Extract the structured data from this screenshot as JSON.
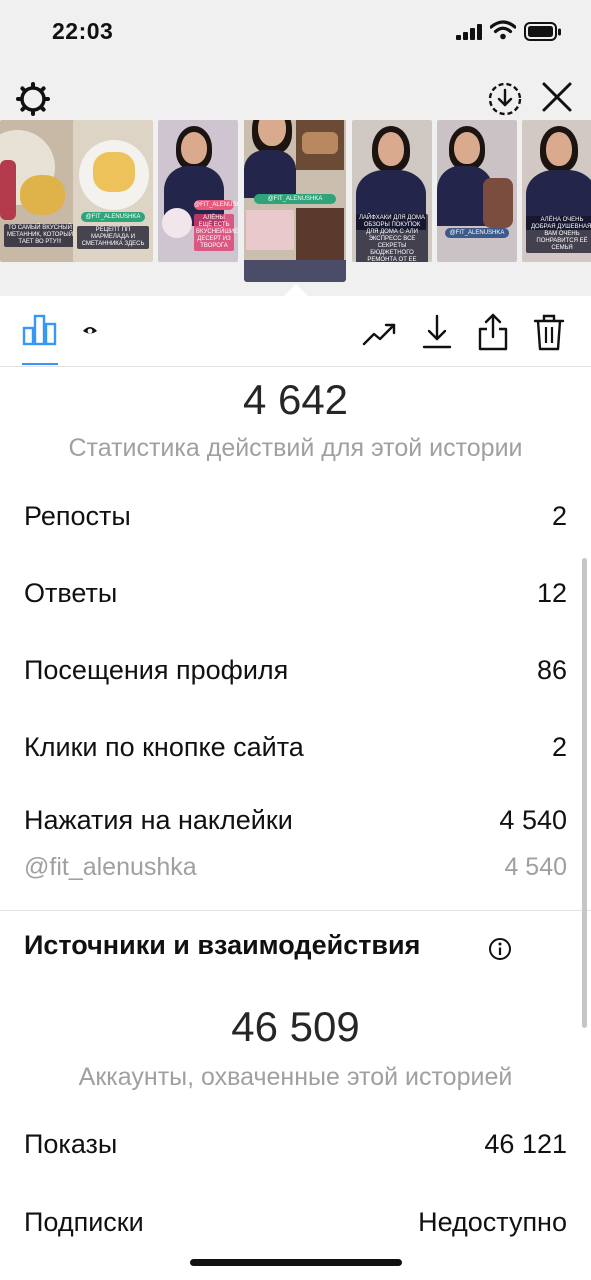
{
  "status_bar": {
    "time": "22:03"
  },
  "thumbnails": [
    {
      "id": "t1",
      "caption": "ТО САМЫЙ ВКУСНЫЙ МЕТАННИК, КОТОРЫЙ ТАЕТ ВО РТУ!!!"
    },
    {
      "id": "t2",
      "tag": "@FIT_ALENUSHKA",
      "caption": "РЕЦЕПТ ПП МАРМЕЛАДА И СМЕТАННИКА ЗДЕСЬ"
    },
    {
      "id": "t3",
      "tag": "@FIT_ALENUSHKA",
      "caption": "АЛЁНЫ ЕЩЁ ЕСТЬ ВКУСНЕЙШИЕ ДЕСЕРТ ИЗ ТВОРОГА"
    },
    {
      "id": "t4",
      "tag": "@FIT_ALENUSHKA"
    },
    {
      "id": "t5",
      "caption": "ЛАЙФХАКИ ДЛЯ ДОМА ОБЗОРЫ ПОКУПОК ДЛЯ ДОМА С АЛИ ЭКСПРЕСС ВСЕ СЕКРЕТЫ БЮДЖЕТНОГО РЕМОНТА ОТ ЕЕ МУЖА"
    },
    {
      "id": "t6",
      "tag": "@FIT_ALENUSHKA"
    },
    {
      "id": "t7",
      "caption": "АЛЁНА ОЧЕНЬ ДОБРАЯ ДУШЕВНАЯ. ВАМ ОЧЕНЬ ПОНРАВИТСЯ ЕЁ СЕМЬЯ"
    }
  ],
  "stats": {
    "total_value": "4 642",
    "total_label": "Статистика действий для этой истории",
    "rows": [
      {
        "label": "Репосты",
        "value": "2"
      },
      {
        "label": "Ответы",
        "value": "12"
      },
      {
        "label": "Посещения профиля",
        "value": "86"
      },
      {
        "label": "Клики по кнопке сайта",
        "value": "2"
      },
      {
        "label": "Нажатия на наклейки",
        "value": "4 540"
      }
    ],
    "sticker_row": {
      "label": "@fit_alenushka",
      "value": "4 540"
    }
  },
  "discovery": {
    "title": "Источники и взаимодействия",
    "total_value": "46 509",
    "total_label": "Аккаунты, охваченные этой историей",
    "rows": [
      {
        "label": "Показы",
        "value": "46 121"
      },
      {
        "label": "Подписки",
        "value": "Недоступно"
      }
    ]
  },
  "colors": {
    "accent": "#3897f0",
    "muted_text": "#a0a0a0",
    "background": "#f0f0f0"
  },
  "icons": {
    "settings": "gear-icon",
    "save_story": "download-circle-icon",
    "close": "close-icon",
    "insights_tab": "bar-chart-icon",
    "viewers_tab": "eye-icon",
    "promote": "trend-up-icon",
    "download": "download-icon",
    "share": "share-icon",
    "delete": "trash-icon",
    "info": "info-icon"
  }
}
